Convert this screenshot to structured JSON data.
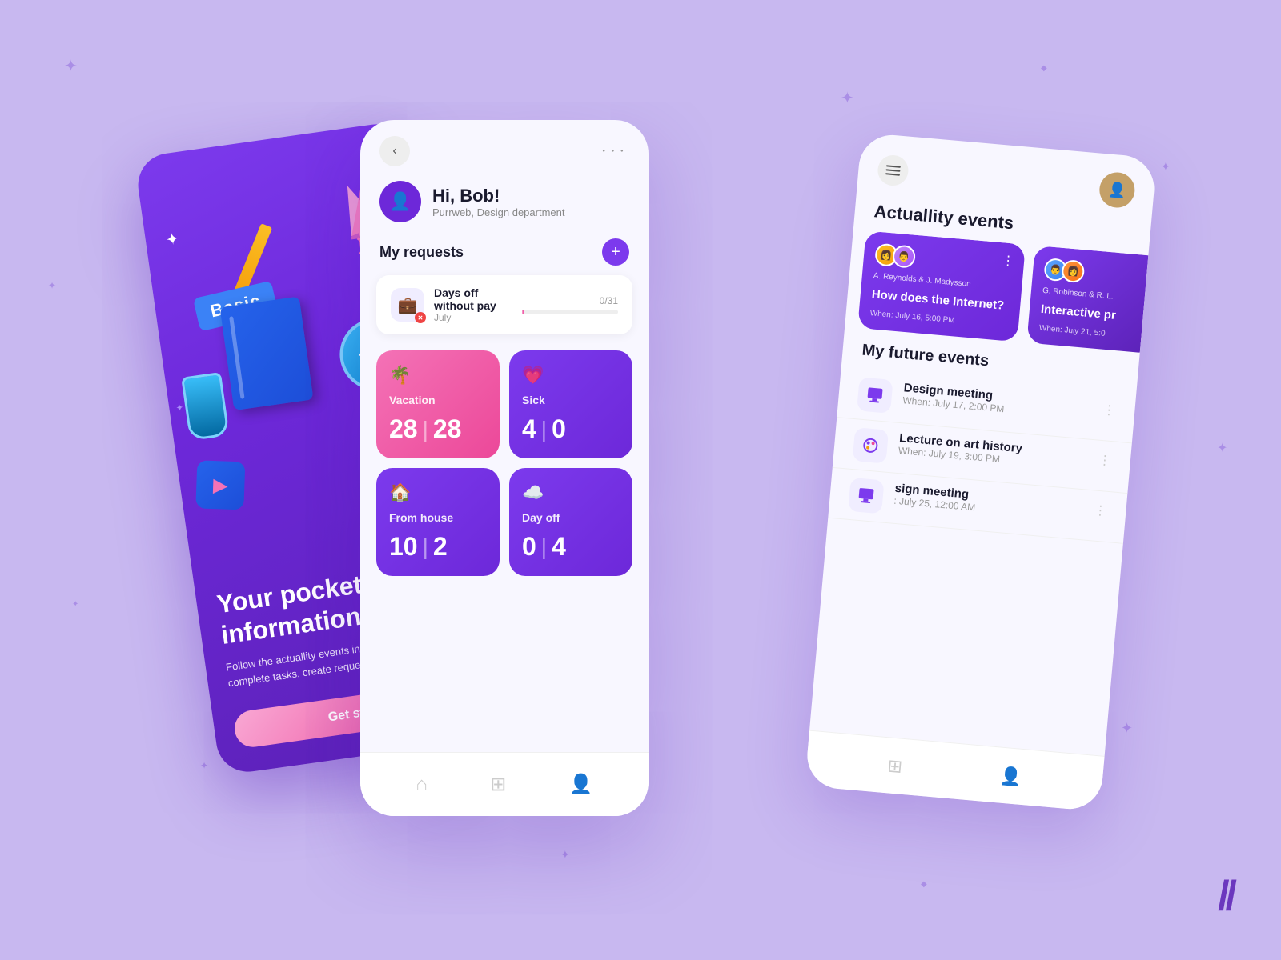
{
  "background": {
    "color": "#c8b8f0"
  },
  "left_card": {
    "badge": "Basic",
    "title": "Your pocket information po",
    "subtitle": "Follow the actuallity events in department, complete tasks, create requests!",
    "button_label": "Get sta"
  },
  "middle_card": {
    "back_button": "‹",
    "more_button": "···",
    "greeting": "Hi, Bob!",
    "department": "Purrweb,  Design department",
    "section_title": "My requests",
    "add_button": "+",
    "request": {
      "name": "Days off without pay",
      "period": "July",
      "progress_label": "0/31"
    },
    "tiles": [
      {
        "type": "vacation",
        "icon": "🌴",
        "label": "Vacation",
        "num1": "28",
        "sep": "|",
        "num2": "28"
      },
      {
        "type": "sick",
        "icon": "💜",
        "label": "Sick",
        "num1": "4",
        "sep": "|",
        "num2": "0"
      },
      {
        "type": "from_house",
        "icon": "🏠",
        "label": "From house",
        "num1": "10",
        "sep": "|",
        "num2": "2"
      },
      {
        "type": "day_off",
        "icon": "☁️",
        "label": "Day off",
        "num1": "0",
        "sep": "|",
        "num2": "4"
      }
    ],
    "nav": [
      {
        "icon": "🏠",
        "label": "home",
        "active": false
      },
      {
        "icon": "⊞",
        "label": "grid",
        "active": false
      },
      {
        "icon": "👤",
        "label": "profile",
        "active": true
      }
    ]
  },
  "right_card": {
    "section_title": "Actuallity events",
    "events": [
      {
        "names": "A. Reynolds & J. Madysson",
        "title": "How does the Internet?",
        "when": "When: July 16, 5:00 PM"
      },
      {
        "names": "G. Robinson & R. L.",
        "title": "Interactive pr",
        "when": "When: July 21, 5:0"
      }
    ],
    "future_title": "My future events",
    "future_events": [
      {
        "icon": "🖥",
        "name": "Design meeting",
        "when": "When: July 17, 2:00 PM"
      },
      {
        "icon": "🎨",
        "name": "Lecture on art history",
        "when": "When: July 19, 3:00 PM"
      },
      {
        "icon": "🖥",
        "name": "sign meeting",
        "when": ": July 25, 12:00 AM"
      }
    ]
  },
  "brand": "//",
  "icons": {
    "back": "‹",
    "more_dots": "⋯",
    "hamburger": "≡",
    "home": "⌂",
    "grid": "⊞",
    "person": "⚇"
  }
}
